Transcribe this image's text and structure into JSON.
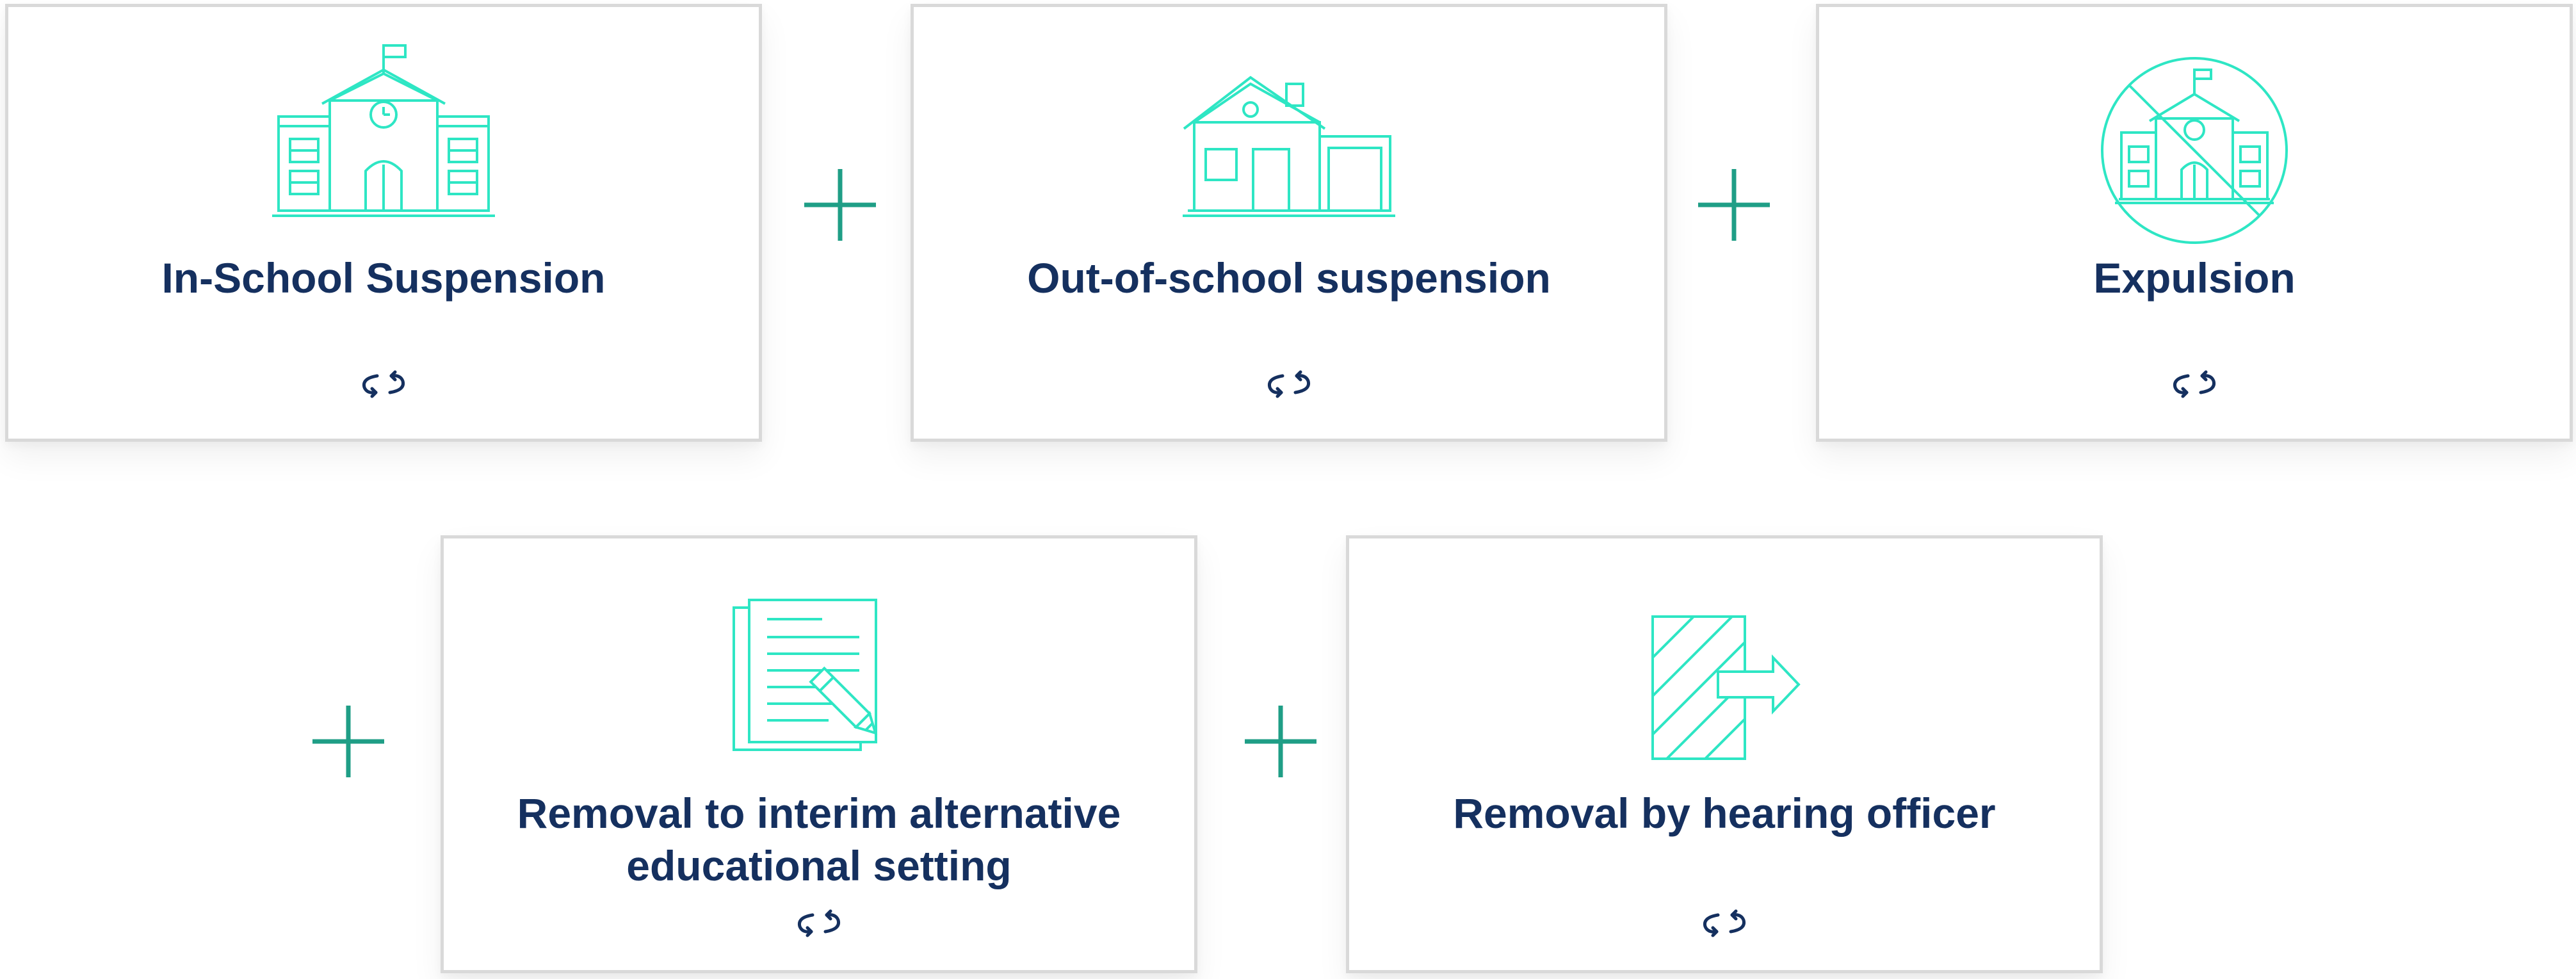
{
  "colors": {
    "icon": "#2ee6c4",
    "plus": "#1f9e86",
    "title": "#15305f",
    "border": "#d9d9d9"
  },
  "cards": [
    {
      "title": "In-School Suspension",
      "icon": "school-building-icon"
    },
    {
      "title": "Out-of-school suspension",
      "icon": "house-garage-icon"
    },
    {
      "title": "Expulsion",
      "icon": "school-crossed-icon"
    },
    {
      "title": "Removal to interim alternative educational setting",
      "icon": "document-pencil-icon"
    },
    {
      "title": "Removal by hearing officer",
      "icon": "exit-door-arrow-icon"
    }
  ],
  "connector_icon": "plus-icon",
  "flip_icon": "flip-arrows-icon"
}
